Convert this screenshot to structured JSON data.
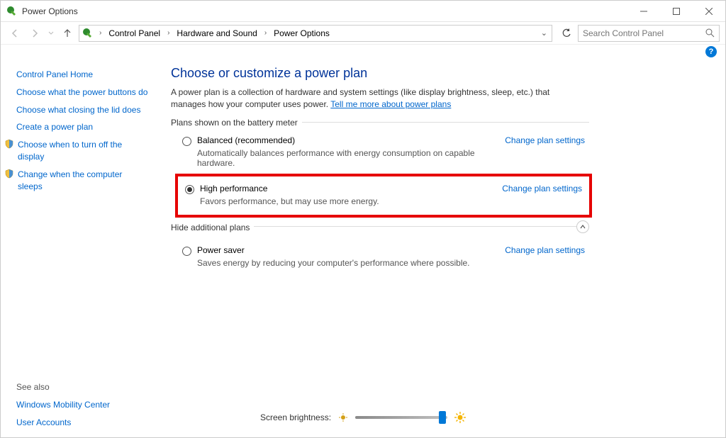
{
  "titlebar": {
    "title": "Power Options"
  },
  "breadcrumb": {
    "items": [
      "Control Panel",
      "Hardware and Sound",
      "Power Options"
    ]
  },
  "search": {
    "placeholder": "Search Control Panel"
  },
  "sidebar": {
    "home": "Control Panel Home",
    "links": [
      "Choose what the power buttons do",
      "Choose what closing the lid does",
      "Create a power plan",
      "Choose when to turn off the display",
      "Change when the computer sleeps"
    ],
    "see_also_header": "See also",
    "see_also": [
      "Windows Mobility Center",
      "User Accounts"
    ]
  },
  "main": {
    "heading": "Choose or customize a power plan",
    "intro": "A power plan is a collection of hardware and system settings (like display brightness, sleep, etc.) that manages how your computer uses power. ",
    "intro_link": "Tell me more about power plans",
    "group1_label": "Plans shown on the battery meter",
    "plans": [
      {
        "name": "Balanced (recommended)",
        "desc": "Automatically balances performance with energy consumption on capable hardware.",
        "change": "Change plan settings",
        "checked": false
      },
      {
        "name": "High performance",
        "desc": "Favors performance, but may use more energy.",
        "change": "Change plan settings",
        "checked": true
      }
    ],
    "collapse_label": "Hide additional plans",
    "extra_plan": {
      "name": "Power saver",
      "desc": "Saves energy by reducing your computer's performance where possible.",
      "change": "Change plan settings"
    },
    "brightness_label": "Screen brightness:"
  }
}
